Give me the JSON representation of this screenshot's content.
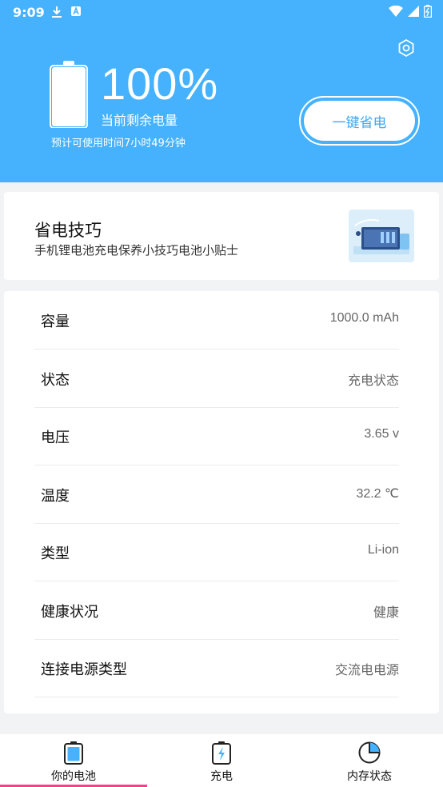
{
  "status_bar": {
    "time": "9:09"
  },
  "header": {
    "percent": "100%",
    "remaining_label": "当前剩余电量",
    "estimate": "预计可使用时间7小时49分钟",
    "save_button": "一键省电",
    "battery_level": 1.0
  },
  "tips": {
    "title": "省电技巧",
    "subtitle": "手机锂电池充电保养小技巧电池小贴士"
  },
  "info": [
    {
      "label": "容量",
      "value": "1000.0 mAh"
    },
    {
      "label": "状态",
      "value": "充电状态"
    },
    {
      "label": "电压",
      "value": "3.65 v"
    },
    {
      "label": "温度",
      "value": "32.2 ℃"
    },
    {
      "label": "类型",
      "value": "Li-ion"
    },
    {
      "label": "健康状况",
      "value": "健康"
    },
    {
      "label": "连接电源类型",
      "value": "交流电电源"
    }
  ],
  "tabs": [
    {
      "label": "你的电池",
      "icon": "battery-icon",
      "selected": true
    },
    {
      "label": "充电",
      "icon": "charging-icon",
      "selected": false
    },
    {
      "label": "内存状态",
      "icon": "pie-chart-icon",
      "selected": false
    }
  ],
  "colors": {
    "accent": "#46b2fd",
    "indicator": "#ff3b8b"
  }
}
